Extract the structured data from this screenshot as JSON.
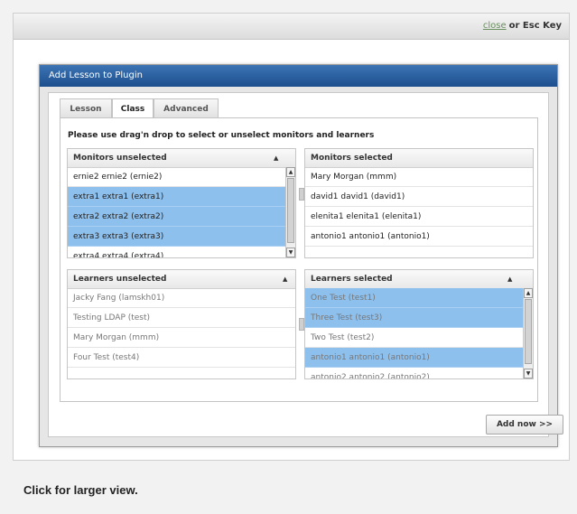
{
  "topbar": {
    "close_link": "close",
    "close_suffix": "or Esc Key"
  },
  "dialog": {
    "title": "Add Lesson to Plugin"
  },
  "tabs": [
    {
      "label": "Lesson",
      "active": false
    },
    {
      "label": "Class",
      "active": true
    },
    {
      "label": "Advanced",
      "active": false
    }
  ],
  "instruction": "Please use drag'n drop to select or unselect monitors and learners",
  "lists": {
    "monitors_unselected": {
      "header": "Monitors unselected",
      "rows": [
        {
          "text": "ernie2 ernie2 (ernie2)",
          "selected": false
        },
        {
          "text": "extra1 extra1 (extra1)",
          "selected": true
        },
        {
          "text": "extra2 extra2 (extra2)",
          "selected": true
        },
        {
          "text": "extra3 extra3 (extra3)",
          "selected": true
        },
        {
          "text": "extra4 extra4 (extra4)",
          "selected": false
        }
      ]
    },
    "monitors_selected": {
      "header": "Monitors selected",
      "rows": [
        {
          "text": "Mary Morgan (mmm)",
          "selected": false
        },
        {
          "text": "david1 david1 (david1)",
          "selected": false
        },
        {
          "text": "elenita1 elenita1 (elenita1)",
          "selected": false
        },
        {
          "text": "antonio1 antonio1 (antonio1)",
          "selected": false
        }
      ]
    },
    "learners_unselected": {
      "header": "Learners unselected",
      "rows": [
        {
          "text": "Jacky Fang (lamskh01)",
          "selected": false
        },
        {
          "text": "Testing LDAP (test)",
          "selected": false
        },
        {
          "text": "Mary Morgan (mmm)",
          "selected": false
        },
        {
          "text": "Four Test (test4)",
          "selected": false
        }
      ]
    },
    "learners_selected": {
      "header": "Learners selected",
      "rows": [
        {
          "text": "One Test (test1)",
          "selected": true
        },
        {
          "text": "Three Test (test3)",
          "selected": true
        },
        {
          "text": "Two Test (test2)",
          "selected": false
        },
        {
          "text": "antonio1 antonio1 (antonio1)",
          "selected": true
        },
        {
          "text": "antonio2 antonio2 (antonio2)",
          "selected": false
        }
      ]
    }
  },
  "add_button": "Add now >>",
  "caption": "Click for larger view.",
  "icons": {
    "sort": "▲",
    "scroll_up": "▲",
    "scroll_down": "▼"
  },
  "colors": {
    "title_bar": "#2a5e9e",
    "selection": "#8ec0ee"
  }
}
